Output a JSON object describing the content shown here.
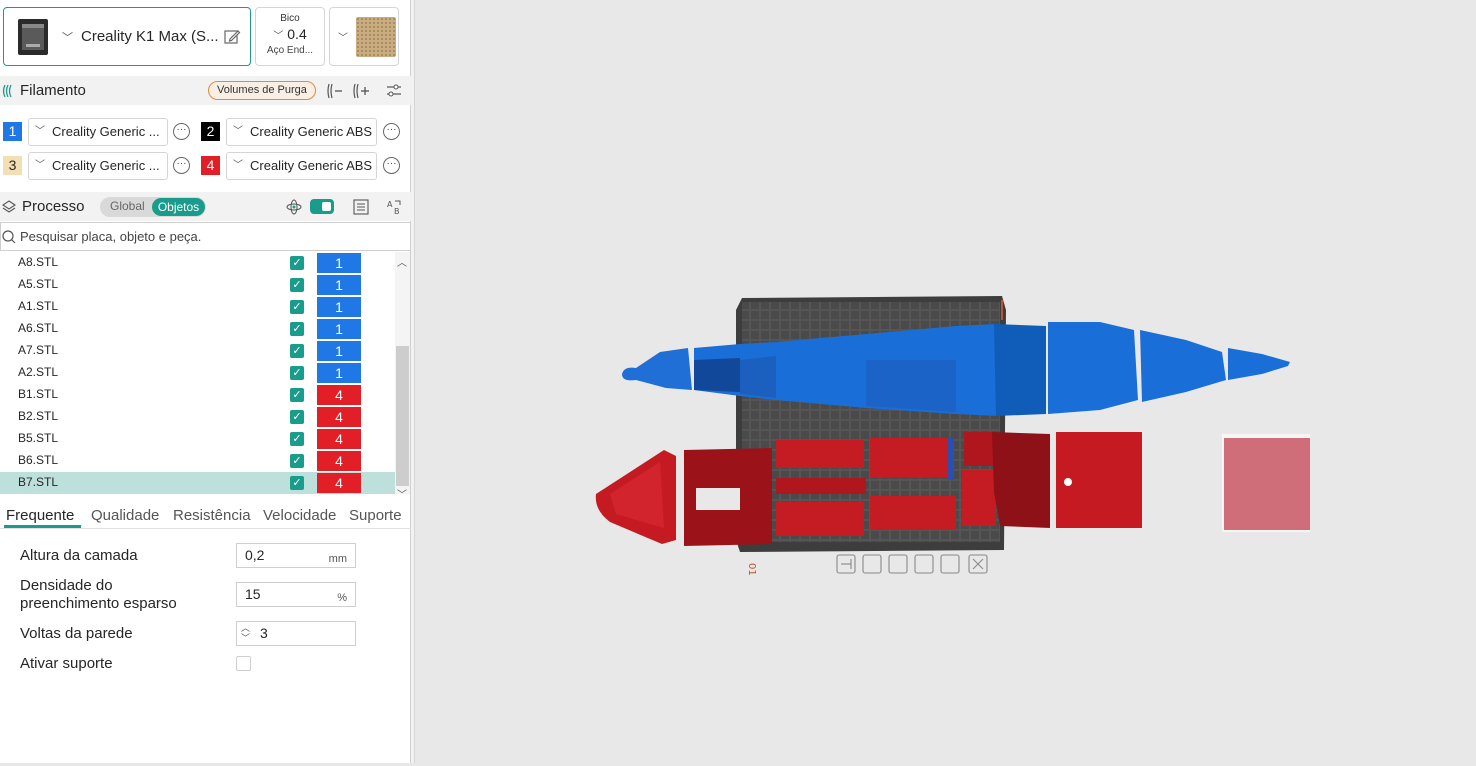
{
  "printer": {
    "name": "Creality K1 Max (S...",
    "icon": "printer-icon"
  },
  "nozzle": {
    "title": "Bico",
    "value": "0.4",
    "sub": "Aço End..."
  },
  "plate": {
    "icon": "plate-texture-icon"
  },
  "filament_section": {
    "title": "Filamento",
    "purge_label": "Volumes de Purga",
    "items": [
      {
        "num": "1",
        "name": "Creality Generic ...",
        "color": "#1f78e6",
        "text_color": "#ffffff"
      },
      {
        "num": "2",
        "name": "Creality Generic ABS",
        "color": "#000000",
        "text_color": "#ffffff"
      },
      {
        "num": "3",
        "name": "Creality Generic ...",
        "color": "#f4dfb5",
        "text_color": "#262626"
      },
      {
        "num": "4",
        "name": "Creality Generic ABS",
        "color": "#e21f26",
        "text_color": "#ffffff"
      }
    ]
  },
  "process_section": {
    "title": "Processo",
    "toggle_global": "Global",
    "toggle_objects": "Objetos"
  },
  "search": {
    "placeholder": "Pesquisar placa, objeto e peça."
  },
  "objects": [
    {
      "name": "A8.STL",
      "filament": "1",
      "color": "#1f78e6",
      "selected": false
    },
    {
      "name": "A5.STL",
      "filament": "1",
      "color": "#1f78e6",
      "selected": false
    },
    {
      "name": "A1.STL",
      "filament": "1",
      "color": "#1f78e6",
      "selected": false
    },
    {
      "name": "A6.STL",
      "filament": "1",
      "color": "#1f78e6",
      "selected": false
    },
    {
      "name": "A7.STL",
      "filament": "1",
      "color": "#1f78e6",
      "selected": false
    },
    {
      "name": "A2.STL",
      "filament": "1",
      "color": "#1f78e6",
      "selected": false
    },
    {
      "name": "B1.STL",
      "filament": "4",
      "color": "#e21f26",
      "selected": false
    },
    {
      "name": "B2.STL",
      "filament": "4",
      "color": "#e21f26",
      "selected": false
    },
    {
      "name": "B5.STL",
      "filament": "4",
      "color": "#e21f26",
      "selected": false
    },
    {
      "name": "B6.STL",
      "filament": "4",
      "color": "#e21f26",
      "selected": false
    },
    {
      "name": "B7.STL",
      "filament": "4",
      "color": "#e21f26",
      "selected": true
    }
  ],
  "tabs": [
    "Frequente",
    "Qualidade",
    "Resistência",
    "Velocidade",
    "Suporte"
  ],
  "params": {
    "layer_height": {
      "label": "Altura da camada",
      "value": "0,2",
      "unit": "mm"
    },
    "infill": {
      "label_line1": "Densidade do",
      "label_line2": "preenchimento esparso",
      "value": "15",
      "unit": "%"
    },
    "walls": {
      "label": "Voltas da parede",
      "value": "3"
    },
    "support": {
      "label": "Ativar suporte",
      "checked": false
    }
  },
  "plate_label": "01",
  "accent": "#1a9c8c"
}
